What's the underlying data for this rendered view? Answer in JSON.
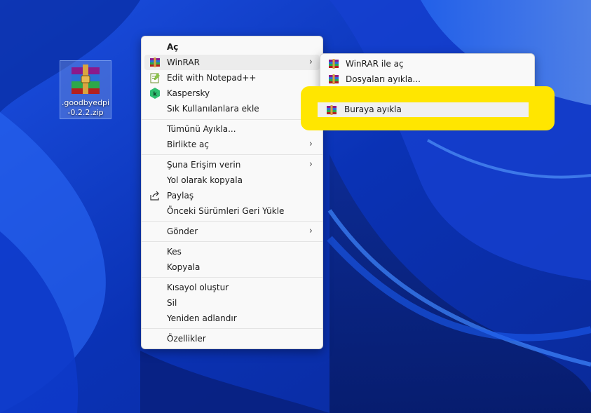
{
  "desktop": {
    "icon_label": ".goodbyedpi-0.2.2.zip"
  },
  "context_menu": {
    "open": "Aç",
    "winrar": "WinRAR",
    "notepad": "Edit with Notepad++",
    "kaspersky": "Kaspersky",
    "favorites": "Sık Kullanılanlara ekle",
    "extract_all": "Tümünü Ayıkla...",
    "open_with": "Birlikte aç",
    "give_access": "Şuna Erişim verin",
    "copy_path": "Yol olarak kopyala",
    "share": "Paylaş",
    "restore": "Önceki Sürümleri Geri Yükle",
    "send_to": "Gönder",
    "cut": "Kes",
    "copy": "Kopyala",
    "shortcut": "Kısayol oluştur",
    "delete": "Sil",
    "rename": "Yeniden adlandır",
    "properties": "Özellikler",
    "arrow": "›"
  },
  "submenu": {
    "open_winrar": "WinRAR ile aç",
    "extract_files": "Dosyaları ayıkla...",
    "extract_here": "Buraya ayıkla"
  },
  "colors": {
    "highlight": "#ffe600",
    "wallpaper_blue": "#0b36b8"
  }
}
